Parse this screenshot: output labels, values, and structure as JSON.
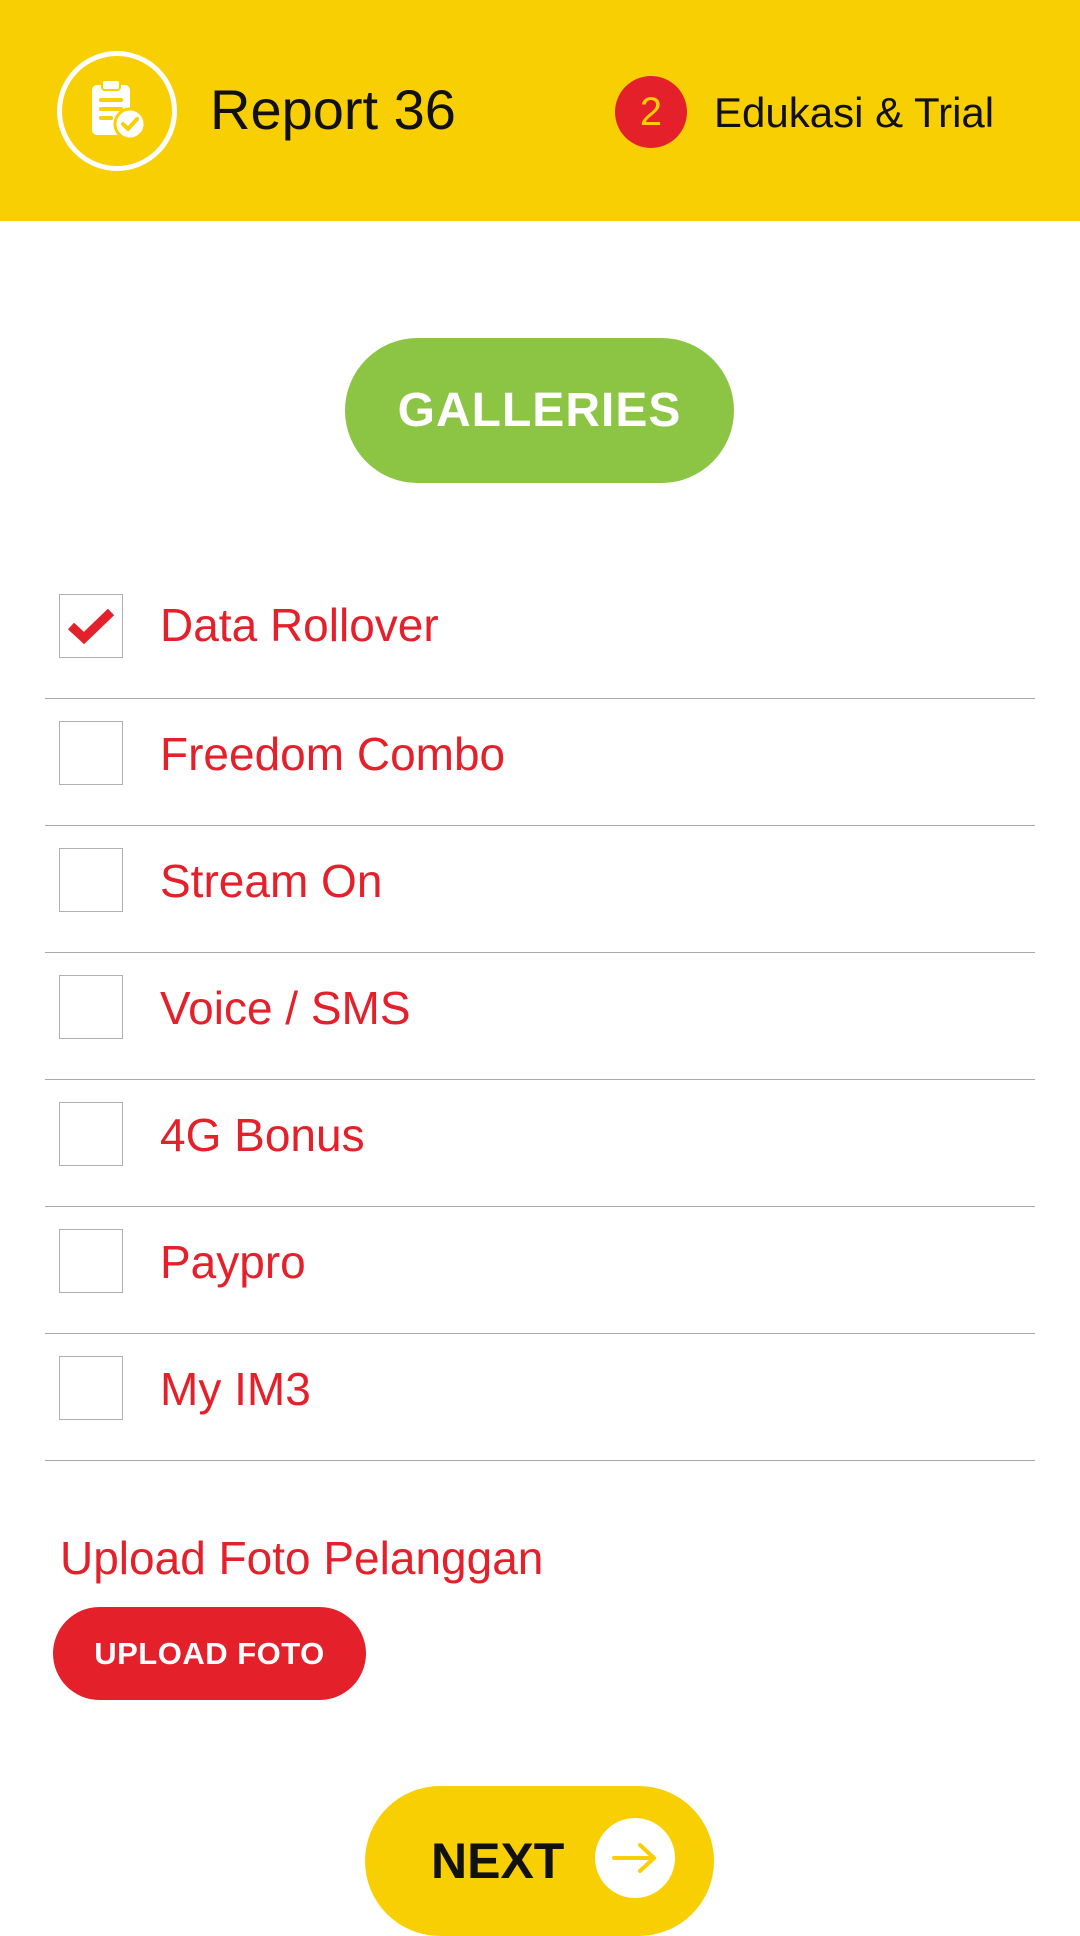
{
  "header": {
    "title": "Report 36",
    "logo_icon": "report-check-icon",
    "step": {
      "number": "2",
      "label": "Edukasi & Trial"
    }
  },
  "galleries_button": {
    "label": "GALLERIES"
  },
  "options": [
    {
      "label": "Data Rollover",
      "checked": true
    },
    {
      "label": "Freedom Combo",
      "checked": false
    },
    {
      "label": "Stream On",
      "checked": false
    },
    {
      "label": "Voice / SMS",
      "checked": false
    },
    {
      "label": "4G Bonus",
      "checked": false
    },
    {
      "label": "Paypro",
      "checked": false
    },
    {
      "label": "My IM3",
      "checked": false
    }
  ],
  "upload": {
    "heading": "Upload Foto Pelanggan",
    "button_label": "UPLOAD FOTO"
  },
  "next_button": {
    "label": "NEXT",
    "icon": "arrow-right-icon"
  },
  "colors": {
    "brand_yellow": "#F7CF02",
    "accent_red": "#E4202B",
    "gallery_green": "#8BC543"
  }
}
